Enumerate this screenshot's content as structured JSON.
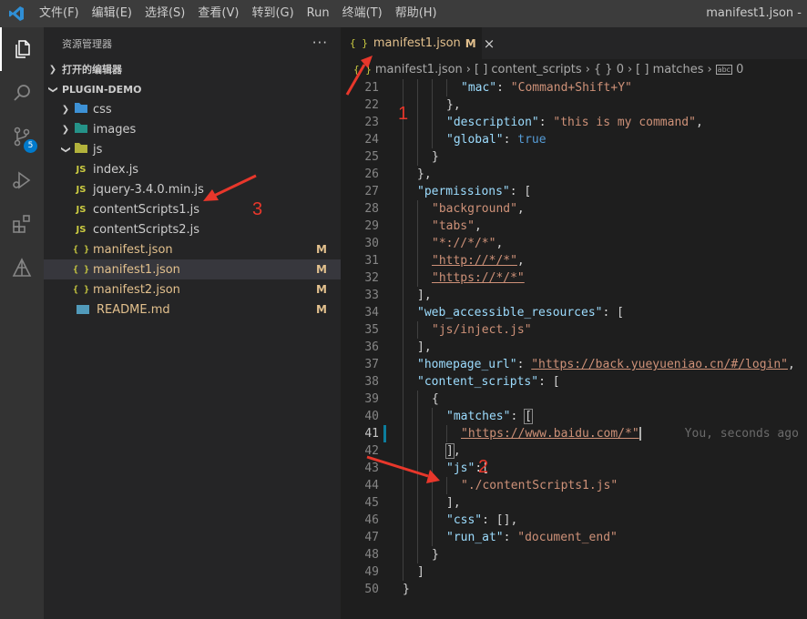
{
  "menubar": {
    "items": [
      "文件(F)",
      "编辑(E)",
      "选择(S)",
      "查看(V)",
      "转到(G)",
      "Run",
      "终端(T)",
      "帮助(H)"
    ],
    "window_title": "manifest1.json -"
  },
  "activity": {
    "scm_badge": "5"
  },
  "sidebar": {
    "title": "资源管理器",
    "open_editors": "打开的编辑器",
    "project": "PLUGIN-DEMO",
    "tree": [
      {
        "label": "css",
        "type": "folder",
        "expanded": false,
        "indent": 1,
        "icon": "css-folder-icon"
      },
      {
        "label": "images",
        "type": "folder",
        "expanded": false,
        "indent": 1,
        "icon": "images-folder-icon"
      },
      {
        "label": "js",
        "type": "folder",
        "expanded": true,
        "indent": 1,
        "icon": "js-folder-icon"
      },
      {
        "label": "index.js",
        "type": "js",
        "indent": 2,
        "icon_text": "JS"
      },
      {
        "label": "jquery-3.4.0.min.js",
        "type": "js",
        "indent": 2,
        "icon_text": "JS"
      },
      {
        "label": "contentScripts1.js",
        "type": "js",
        "indent": 1,
        "icon_text": "JS"
      },
      {
        "label": "contentScripts2.js",
        "type": "js",
        "indent": 1,
        "icon_text": "JS"
      },
      {
        "label": "manifest.json",
        "type": "json",
        "indent": 1,
        "icon_text": "{ }",
        "status": "M",
        "color": "#e2c08d"
      },
      {
        "label": "manifest1.json",
        "type": "json",
        "indent": 1,
        "icon_text": "{ }",
        "status": "M",
        "color": "#e2c08d",
        "selected": true
      },
      {
        "label": "manifest2.json",
        "type": "json",
        "indent": 1,
        "icon_text": "{ }",
        "status": "M",
        "color": "#e2c08d"
      },
      {
        "label": "README.md",
        "type": "md",
        "indent": 1,
        "status": "M",
        "color": "#e2c08d"
      }
    ]
  },
  "tab": {
    "icon": "{ }",
    "label": "manifest1.json",
    "status": "M",
    "close": "×"
  },
  "breadcrumb": {
    "icon": "{ }",
    "items": [
      "manifest1.json",
      "[ ] content_scripts",
      "{ } 0",
      "[ ] matches"
    ],
    "last": "0"
  },
  "editor": {
    "cursor_line": 41,
    "blame": "You, seconds ago •",
    "lines": [
      {
        "n": 21,
        "g": 4,
        "t": [
          [
            "k",
            "\"mac\""
          ],
          [
            "p",
            ": "
          ],
          [
            "s",
            "\"Command+Shift+Y\""
          ]
        ]
      },
      {
        "n": 22,
        "g": 3,
        "t": [
          [
            "p",
            "},"
          ]
        ]
      },
      {
        "n": 23,
        "g": 3,
        "t": [
          [
            "k",
            "\"description\""
          ],
          [
            "p",
            ": "
          ],
          [
            "s",
            "\"this is my command\""
          ],
          [
            "p",
            ","
          ]
        ]
      },
      {
        "n": 24,
        "g": 3,
        "t": [
          [
            "k",
            "\"global\""
          ],
          [
            "p",
            ": "
          ],
          [
            "b",
            "true"
          ]
        ]
      },
      {
        "n": 25,
        "g": 2,
        "t": [
          [
            "p",
            "}"
          ]
        ]
      },
      {
        "n": 26,
        "g": 1,
        "t": [
          [
            "p",
            "},"
          ]
        ]
      },
      {
        "n": 27,
        "g": 1,
        "t": [
          [
            "k",
            "\"permissions\""
          ],
          [
            "p",
            ": ["
          ]
        ]
      },
      {
        "n": 28,
        "g": 2,
        "t": [
          [
            "s",
            "\"background\""
          ],
          [
            "p",
            ","
          ]
        ]
      },
      {
        "n": 29,
        "g": 2,
        "t": [
          [
            "s",
            "\"tabs\""
          ],
          [
            "p",
            ","
          ]
        ]
      },
      {
        "n": 30,
        "g": 2,
        "t": [
          [
            "s",
            "\"*://*/*\""
          ],
          [
            "p",
            ","
          ]
        ]
      },
      {
        "n": 31,
        "g": 2,
        "t": [
          [
            "su",
            "\"http://*/*\""
          ],
          [
            "p",
            ","
          ]
        ]
      },
      {
        "n": 32,
        "g": 2,
        "t": [
          [
            "su",
            "\"https://*/*\""
          ]
        ]
      },
      {
        "n": 33,
        "g": 1,
        "t": [
          [
            "p",
            "],"
          ]
        ]
      },
      {
        "n": 34,
        "g": 1,
        "t": [
          [
            "k",
            "\"web_accessible_resources\""
          ],
          [
            "p",
            ": ["
          ]
        ]
      },
      {
        "n": 35,
        "g": 2,
        "t": [
          [
            "s",
            "\"js/inject.js\""
          ]
        ]
      },
      {
        "n": 36,
        "g": 1,
        "t": [
          [
            "p",
            "],"
          ]
        ]
      },
      {
        "n": 37,
        "g": 1,
        "t": [
          [
            "k",
            "\"homepage_url\""
          ],
          [
            "p",
            ": "
          ],
          [
            "su",
            "\"https://back.yueyueniao.cn/#/login\""
          ],
          [
            "p",
            ","
          ]
        ]
      },
      {
        "n": 38,
        "g": 1,
        "t": [
          [
            "k",
            "\"content_scripts\""
          ],
          [
            "p",
            ": ["
          ]
        ]
      },
      {
        "n": 39,
        "g": 2,
        "t": [
          [
            "p",
            "{"
          ]
        ]
      },
      {
        "n": 40,
        "g": 3,
        "t": [
          [
            "k",
            "\"matches\""
          ],
          [
            "p",
            ": "
          ],
          [
            "pb",
            "["
          ]
        ]
      },
      {
        "n": 41,
        "g": 4,
        "t": [
          [
            "su",
            "\"https://www.baidu.com/*\""
          ],
          [
            "cur",
            ""
          ]
        ],
        "blame": true
      },
      {
        "n": 42,
        "g": 3,
        "t": [
          [
            "pb",
            "]"
          ],
          [
            "p",
            ","
          ]
        ]
      },
      {
        "n": 43,
        "g": 3,
        "t": [
          [
            "k",
            "\"js\""
          ],
          [
            "p",
            ":["
          ]
        ]
      },
      {
        "n": 44,
        "g": 4,
        "t": [
          [
            "s",
            "\"./contentScripts1.js\""
          ]
        ]
      },
      {
        "n": 45,
        "g": 3,
        "t": [
          [
            "p",
            "],"
          ]
        ]
      },
      {
        "n": 46,
        "g": 3,
        "t": [
          [
            "k",
            "\"css\""
          ],
          [
            "p",
            ": [],"
          ]
        ]
      },
      {
        "n": 47,
        "g": 3,
        "t": [
          [
            "k",
            "\"run_at\""
          ],
          [
            "p",
            ": "
          ],
          [
            "s",
            "\"document_end\""
          ]
        ]
      },
      {
        "n": 48,
        "g": 2,
        "t": [
          [
            "p",
            "}"
          ]
        ]
      },
      {
        "n": 49,
        "g": 1,
        "t": [
          [
            "p",
            "]"
          ]
        ]
      },
      {
        "n": 50,
        "g": 0,
        "t": [
          [
            "p",
            "}"
          ]
        ]
      }
    ]
  },
  "annotations": {
    "labels": [
      "1",
      "2",
      "3"
    ],
    "color": "#e8372b"
  }
}
